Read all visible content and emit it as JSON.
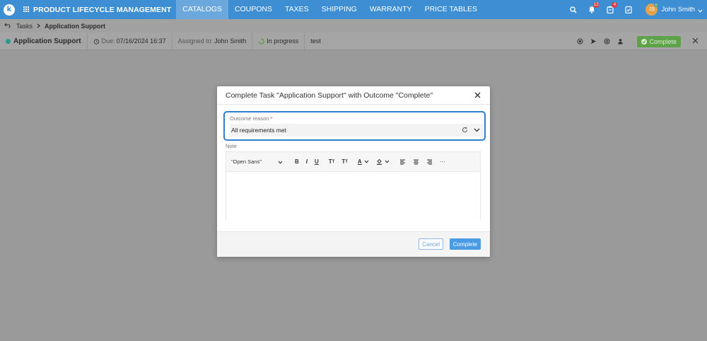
{
  "topnav": {
    "logo_letter": "k",
    "app_title": "PRODUCT LIFECYCLE MANAGEMENT",
    "items": [
      {
        "label": "CATALOGS"
      },
      {
        "label": "COUPONS"
      },
      {
        "label": "TAXES"
      },
      {
        "label": "SHIPPING"
      },
      {
        "label": "WARRANTY"
      },
      {
        "label": "PRICE TABLES"
      }
    ],
    "notifications_count": "12",
    "tasks_count": "4",
    "avatar_initials": "JS",
    "user_name": "John Smith",
    "accent_color": "#3d8ed2"
  },
  "breadcrumb": {
    "root": "Tasks",
    "current": "Application Support"
  },
  "taskbar": {
    "title": "Application Support",
    "due_label": "Due:",
    "due_value": "07/16/2024 16:37",
    "assigned_label": "Assigned to:",
    "assigned_value": "John Smith",
    "status": "In progress",
    "extra": "test",
    "complete_label": "Complete",
    "status_dot_color": "#239c8a",
    "complete_color": "#5ea34a"
  },
  "modal": {
    "title": "Complete Task \"Application Support\" with Outcome \"Complete\"",
    "outcome_label": "Outcome reason",
    "required_mark": "*",
    "outcome_value": "All requirements met",
    "note_label": "Note",
    "font_value": "\"Open Sans\"",
    "toolbar": {
      "bold": "B",
      "italic": "I",
      "underline": "U",
      "superscript": "T",
      "subscript": "T",
      "text_color": "A",
      "more": "···"
    },
    "cancel_label": "Cancel",
    "complete_label": "Complete"
  }
}
